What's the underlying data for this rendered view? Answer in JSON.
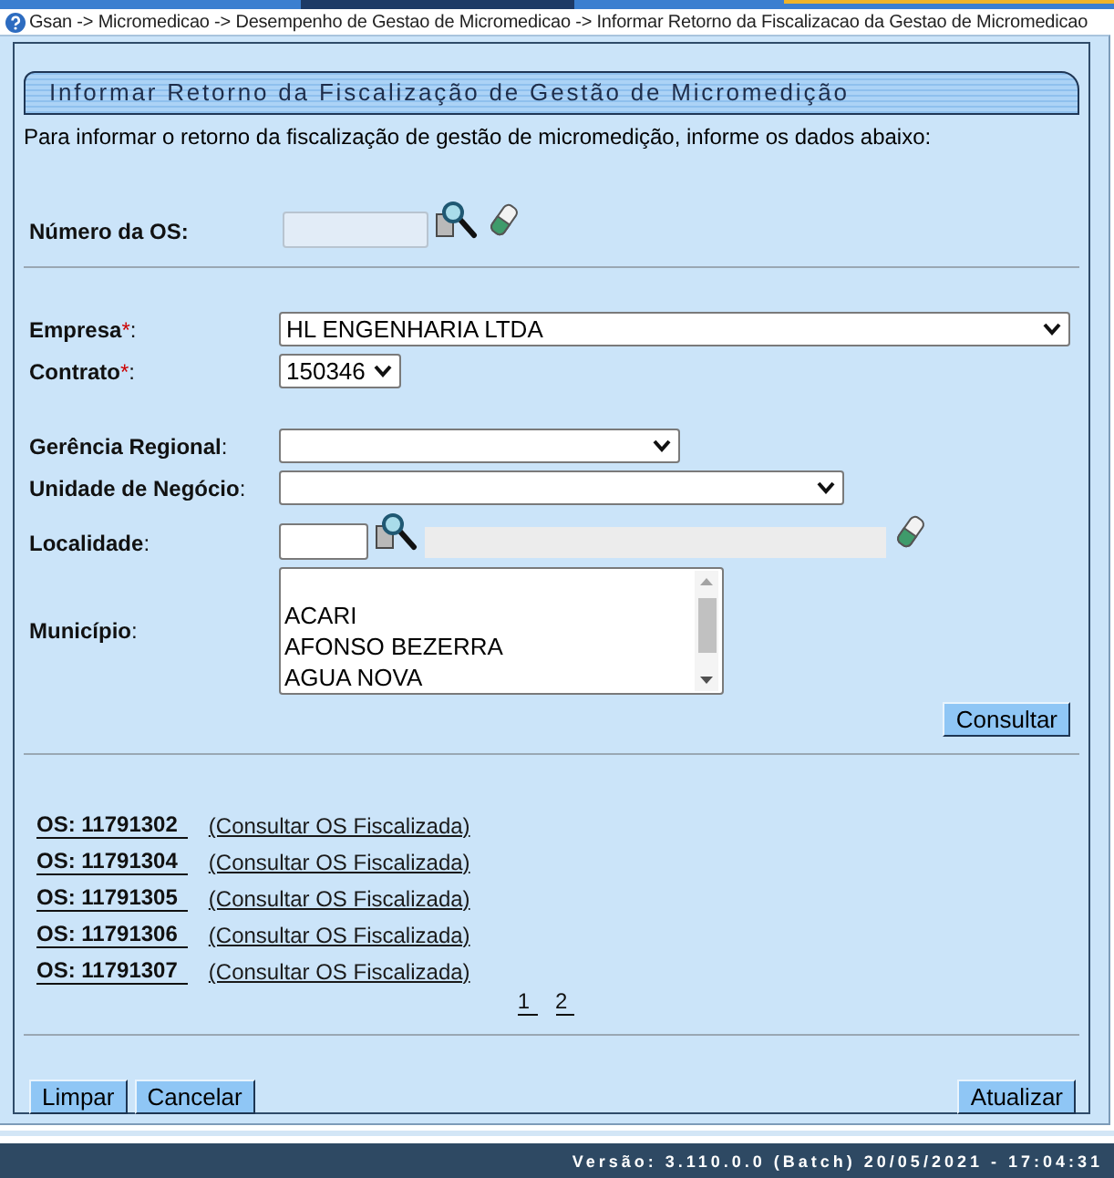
{
  "breadcrumb": "Gsan -> Micromedicao -> Desempenho de Gestao de Micromedicao -> Informar Retorno da Fiscalizacao da Gestao de Micromedicao",
  "panel": {
    "title": "Informar Retorno da Fiscalização de Gestão de Micromedição",
    "instructions": "Para informar o retorno da fiscalização de gestão de micromedição, informe os dados abaixo:"
  },
  "sections": [
    {
      "groups": [
        [
          {
            "kind": "lookup",
            "label": "Número da OS:",
            "readonly": true
          }
        ]
      ]
    },
    {
      "groups": [
        [
          {
            "kind": "select",
            "label": "Empresa",
            "required_mark": "*",
            "colon": ":",
            "value": "HL ENGENHARIA LTDA"
          },
          {
            "kind": "select",
            "label": "Contrato",
            "required_mark": "*",
            "colon": ":",
            "value": "150346"
          }
        ],
        [
          {
            "kind": "select",
            "label": "Gerência Regional",
            "colon": ":"
          },
          {
            "kind": "select",
            "label": "Unidade de Negócio",
            "colon": ":"
          },
          {
            "kind": "lookup",
            "label": "Localidade",
            "colon": ":",
            "readonly": false,
            "description_field": true
          },
          {
            "kind": "listbox",
            "label": "Município",
            "colon": ":",
            "options": [
              "ACARI",
              "AFONSO BEZERRA",
              "AGUA NOVA"
            ]
          }
        ]
      ],
      "action": "Consultar"
    }
  ],
  "results": [
    {
      "os": "OS: 11791302",
      "action": "(Consultar OS Fiscalizada)"
    },
    {
      "os": "OS: 11791304",
      "action": "(Consultar OS Fiscalizada)"
    },
    {
      "os": "OS: 11791305",
      "action": "(Consultar OS Fiscalizada)"
    },
    {
      "os": "OS: 11791306",
      "action": "(Consultar OS Fiscalizada)"
    },
    {
      "os": "OS: 11791307",
      "action": "(Consultar OS Fiscalizada)"
    }
  ],
  "pages": [
    "1",
    "2"
  ],
  "buttons": {
    "left": [
      "Limpar",
      "Cancelar"
    ],
    "right": [
      "Atualizar"
    ]
  },
  "version": "Versão: 3.110.0.0 (Batch) 20/05/2021 - 17:04:31"
}
